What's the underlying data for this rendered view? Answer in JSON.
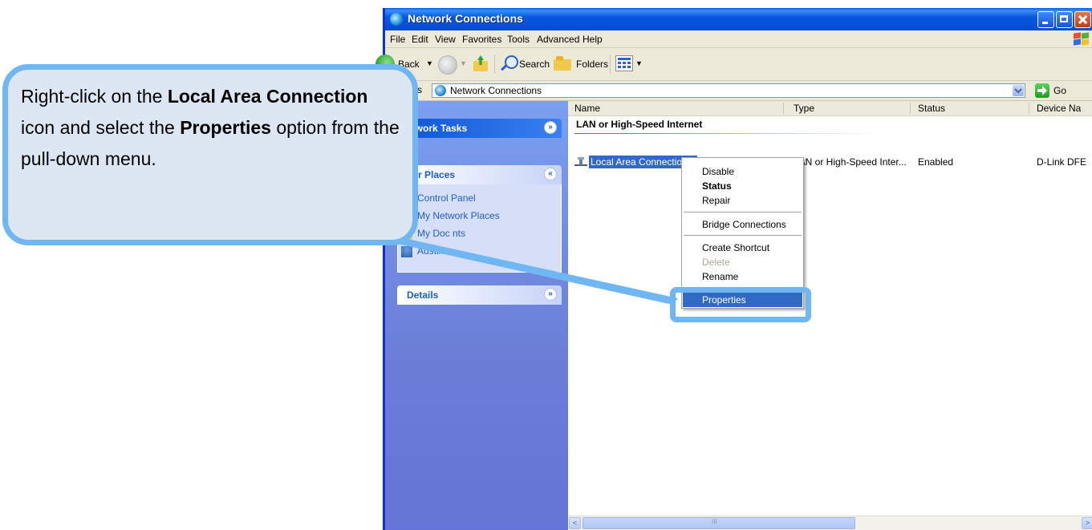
{
  "window": {
    "title": "Network Connections",
    "menu": [
      "File",
      "Edit",
      "View",
      "Favorites",
      "Tools",
      "Advanced",
      "Help"
    ],
    "toolbar": {
      "back": "Back",
      "search": "Search",
      "folders": "Folders"
    },
    "address": {
      "label": "s",
      "value": "Network Connections",
      "go": "Go"
    }
  },
  "left_pane": {
    "network_tasks": "etwork Tasks",
    "other_places": {
      "title": "her Places",
      "links": [
        "Control Panel",
        "My Network Places",
        "My Doc   nts",
        "Austin"
      ]
    },
    "details": "Details"
  },
  "file_pane": {
    "columns": [
      "Name",
      "Type",
      "Status",
      "Device Na"
    ],
    "group": "LAN or High-Speed Internet",
    "row": {
      "name": "Local Area Connection 2",
      "type": "LAN or High-Speed Inter...",
      "status": "Enabled",
      "device": "D-Link DFE"
    },
    "scroll_label": "III"
  },
  "context_menu": {
    "items": [
      "Disable",
      "Status",
      "Repair",
      "Bridge Connections",
      "Create Shortcut",
      "Delete",
      "Rename",
      "Properties"
    ]
  },
  "callout": {
    "t1": "Right-click on the ",
    "b1": "Local Area Connection",
    "t2": " icon and select the ",
    "b2": "Properties",
    "t3": " option from the pull-down menu."
  },
  "colors": {
    "titlebar": "#0a5fe8",
    "selection": "#316ac5",
    "callout_border": "#6fb6f2",
    "callout_fill": "#dde6f3",
    "task_pane": "#6b7ed7"
  }
}
